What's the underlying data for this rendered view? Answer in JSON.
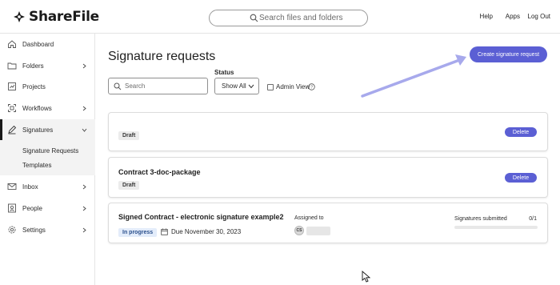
{
  "header": {
    "brand": "ShareFile",
    "search_placeholder": "Search files and folders",
    "links": {
      "help": "Help",
      "apps": "Apps",
      "logout": "Log Out"
    }
  },
  "sidebar": {
    "items": [
      {
        "label": "Dashboard",
        "icon": "home-icon"
      },
      {
        "label": "Folders",
        "icon": "folder-icon"
      },
      {
        "label": "Projects",
        "icon": "projects-icon"
      },
      {
        "label": "Workflows",
        "icon": "workflow-icon"
      },
      {
        "label": "Signatures",
        "icon": "pen-icon"
      },
      {
        "label": "Inbox",
        "icon": "mail-icon"
      },
      {
        "label": "People",
        "icon": "person-icon"
      },
      {
        "label": "Settings",
        "icon": "gear-icon"
      }
    ],
    "sub_items": [
      "Signature Requests",
      "Templates"
    ]
  },
  "main": {
    "title": "Signature requests",
    "create_label": "Create signature request",
    "search_placeholder": "Search",
    "status_label": "Status",
    "status_value": "Show All",
    "admin_view_label": "Admin View",
    "delete_label": "Delete",
    "cards": [
      {
        "title": "",
        "badge": "Draft"
      },
      {
        "title": "Contract 3-doc-package",
        "badge": "Draft"
      },
      {
        "title": "Signed Contract - electronic signature example2",
        "badge": "In progress",
        "due": "Due November 30, 2023",
        "assigned_label": "Assigned to",
        "assignee_initials": "CS",
        "signatures_label": "Signatures submitted",
        "signatures_count": "0/1"
      }
    ]
  },
  "colors": {
    "accent": "#5b5fd4",
    "annotation_arrow": "#a7a9ec"
  }
}
